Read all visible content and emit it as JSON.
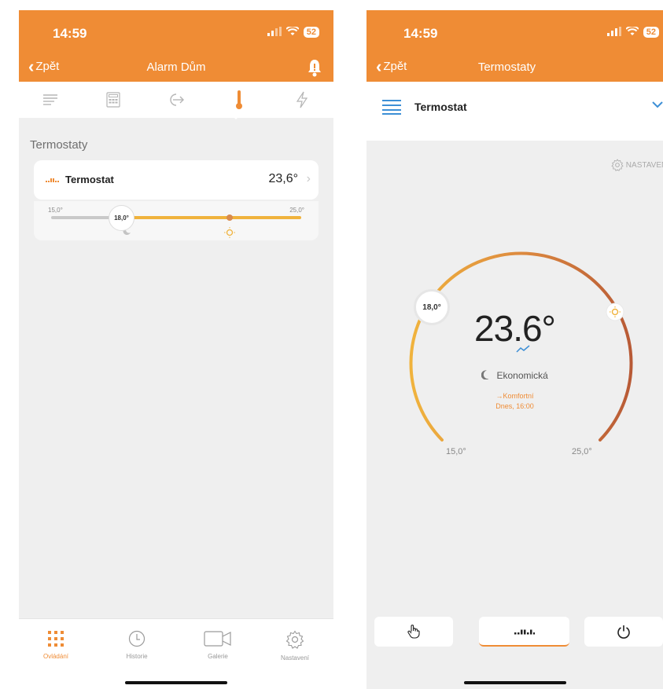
{
  "colors": {
    "accent": "#ef8c35",
    "gauge_start": "#f0b33d",
    "gauge_end": "#b85a36",
    "background": "#efefef"
  },
  "left": {
    "status": {
      "time": "14:59",
      "battery": "52"
    },
    "nav": {
      "back_label": "Zpět",
      "title": "Alarm Dům"
    },
    "top_tabs": [
      "list-icon",
      "keypad-icon",
      "exit-icon",
      "thermometer-icon",
      "lightning-icon"
    ],
    "section_title": "Termostaty",
    "thermostat": {
      "name": "Termostat",
      "value": "23,6°",
      "slider": {
        "min_label": "15,0°",
        "max_label": "25,0°",
        "knob_label": "18,0°"
      }
    },
    "bottom_tabs": [
      {
        "label": "Ovládání",
        "icon": "grid-icon"
      },
      {
        "label": "Historie",
        "icon": "clock-icon"
      },
      {
        "label": "Galerie",
        "icon": "camera-icon"
      },
      {
        "label": "Nastavení",
        "icon": "gear-icon"
      }
    ]
  },
  "right": {
    "status": {
      "time": "14:59",
      "battery": "52"
    },
    "nav": {
      "back_label": "Zpět",
      "title": "Termostaty"
    },
    "header_title": "Termostat",
    "settings_label": "NASTAVENÍ",
    "gauge": {
      "current": "23.6°",
      "setpoint_label": "18,0°",
      "min_label": "15,0°",
      "max_label": "25,0°",
      "mode": "Ekonomická",
      "next_mode": "→Komfortní",
      "next_time": "Dnes, 16:00"
    },
    "controls": [
      "hand-icon",
      "schedule-icon",
      "power-icon"
    ]
  }
}
